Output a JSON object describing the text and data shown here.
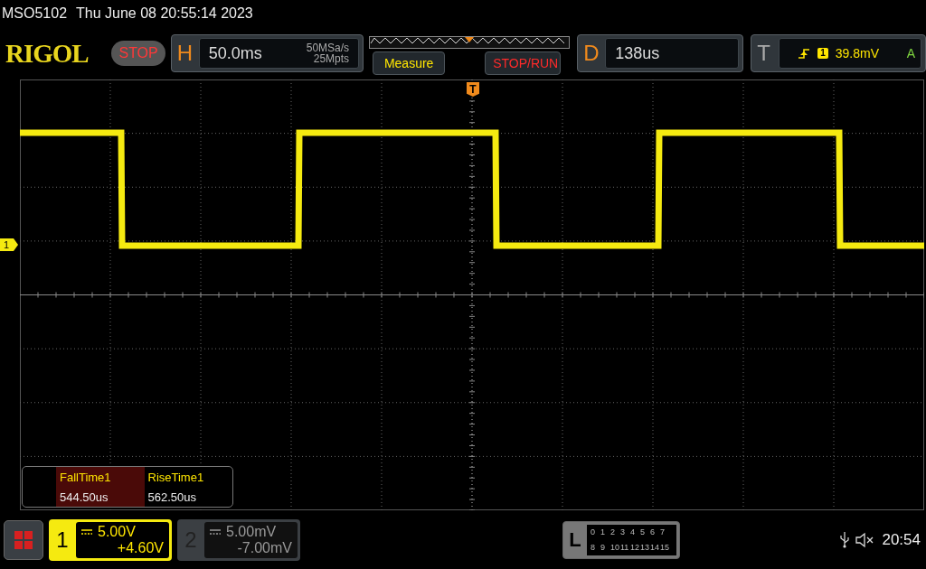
{
  "title_bar": {
    "model": "MSO5102",
    "datetime": "Thu June 08 20:55:14 2023"
  },
  "toolbar": {
    "logo": "RIGOL",
    "run_state": "STOP",
    "horizontal": {
      "letter": "H",
      "scale": "50.0ms",
      "sample_rate": "50MSa/s",
      "memory_depth": "25Mpts"
    },
    "buttons": [
      {
        "label": "Measure",
        "kind": "measure"
      },
      {
        "label": "STOP/RUN",
        "kind": "stoprun"
      }
    ],
    "delay": {
      "letter": "D",
      "value": "138us"
    },
    "trigger": {
      "letter": "T",
      "channel": "1",
      "trigger_level": "39.8mV",
      "mode": "A"
    }
  },
  "graticule": {
    "trigger_marker": "T",
    "channel_marker": "1"
  },
  "measurements": [
    {
      "name": "FallTime1",
      "value": "544.50us",
      "selected": true
    },
    {
      "name": "RiseTime1",
      "value": "562.50us",
      "selected": false
    }
  ],
  "channels": [
    {
      "number": "1",
      "scale": "5.00V",
      "offset": "+4.60V",
      "active": true
    },
    {
      "number": "2",
      "scale": "5.00mV",
      "offset": "-7.00mV",
      "active": false
    }
  ],
  "logic": {
    "letter": "L",
    "rows": [
      [
        "0",
        "1",
        "2",
        "3",
        "4",
        "5",
        "6",
        "7"
      ],
      [
        "8",
        "9",
        "10",
        "11",
        "12",
        "13",
        "14",
        "15"
      ]
    ]
  },
  "clock": "20:54"
}
